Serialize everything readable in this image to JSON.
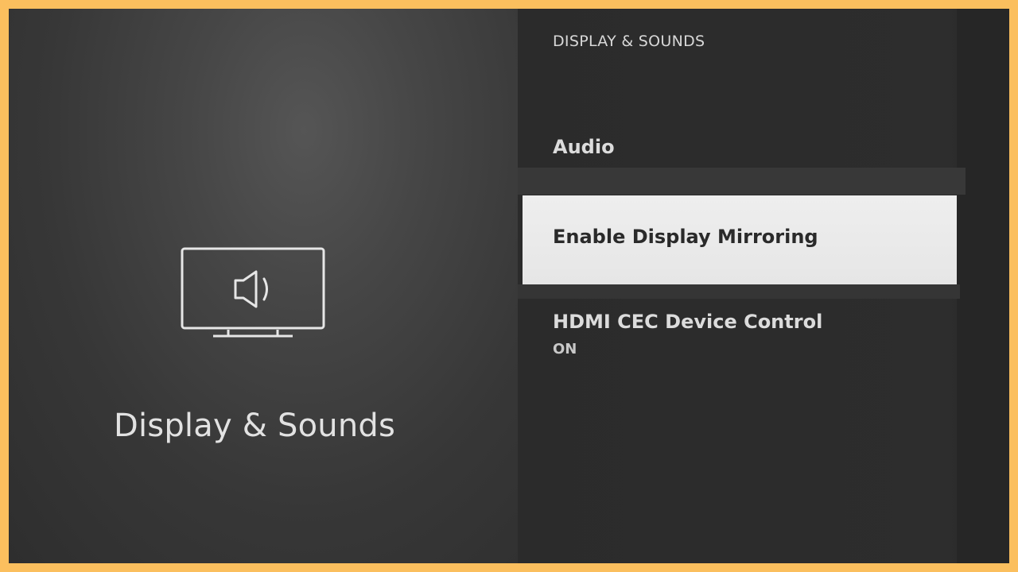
{
  "hero": {
    "icon": "tv-speaker-icon",
    "title": "Display & Sounds"
  },
  "menu": {
    "header": "DISPLAY & SOUNDS",
    "items": [
      {
        "label": "Audio",
        "value": ""
      },
      {
        "label": "Enable Display Mirroring",
        "value": "",
        "focused": true
      },
      {
        "label": "HDMI CEC Device Control",
        "value": "ON"
      }
    ]
  },
  "colors": {
    "frame": "#fbbf5e",
    "background": "#2c2c2c",
    "focus": "#eeeeee"
  }
}
